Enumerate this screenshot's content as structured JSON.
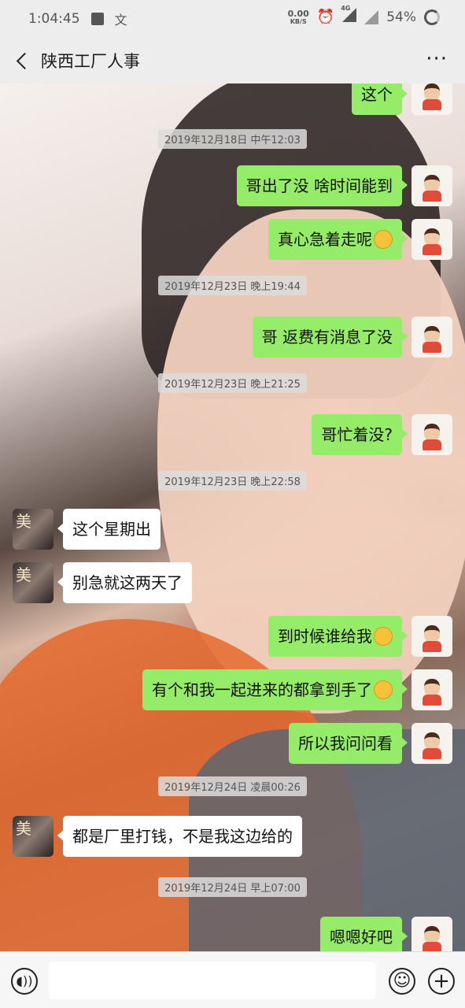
{
  "status_bar": {
    "time": "1:04:45",
    "net_speed_value": "0.00",
    "net_speed_unit": "KB/S",
    "network": "4G",
    "battery": "54%"
  },
  "nav": {
    "title": "陕西工厂人事",
    "more": "···"
  },
  "messages": [
    {
      "type": "msg",
      "side": "me",
      "text": "这个"
    },
    {
      "type": "time",
      "text": "2019年12月18日 中午12:03"
    },
    {
      "type": "msg",
      "side": "me",
      "text": "哥出了没 啥时间能到"
    },
    {
      "type": "msg",
      "side": "me",
      "text": "真心急着走呢",
      "emoji": "crying-laughing-emoji"
    },
    {
      "type": "time",
      "text": "2019年12月23日 晚上19:44"
    },
    {
      "type": "msg",
      "side": "me",
      "text": "哥 返费有消息了没"
    },
    {
      "type": "time",
      "text": "2019年12月23日 晚上21:25"
    },
    {
      "type": "msg",
      "side": "me",
      "text": "哥忙着没?"
    },
    {
      "type": "time",
      "text": "2019年12月23日 晚上22:58"
    },
    {
      "type": "msg",
      "side": "other",
      "text": "这个星期出"
    },
    {
      "type": "msg",
      "side": "other",
      "text": "别急就这两天了"
    },
    {
      "type": "msg",
      "side": "me",
      "text": "到时候谁给我",
      "emoji": "blushing-emoji"
    },
    {
      "type": "msg",
      "side": "me",
      "text": "有个和我一起进来的都拿到手了",
      "emoji": "tears-of-joy-emoji"
    },
    {
      "type": "msg",
      "side": "me",
      "text": "所以我问问看"
    },
    {
      "type": "time",
      "text": "2019年12月24日 凌晨00:26"
    },
    {
      "type": "msg",
      "side": "other",
      "text": "都是厂里打钱，不是我这边给的"
    },
    {
      "type": "time",
      "text": "2019年12月24日 早上07:00"
    },
    {
      "type": "msg",
      "side": "me",
      "text": "嗯嗯好吧"
    }
  ],
  "other_avatar_text": "美",
  "input_bar": {
    "voice_icon": "voice-icon",
    "emoji_icon": "emoji-icon",
    "plus_icon": "plus-icon"
  }
}
